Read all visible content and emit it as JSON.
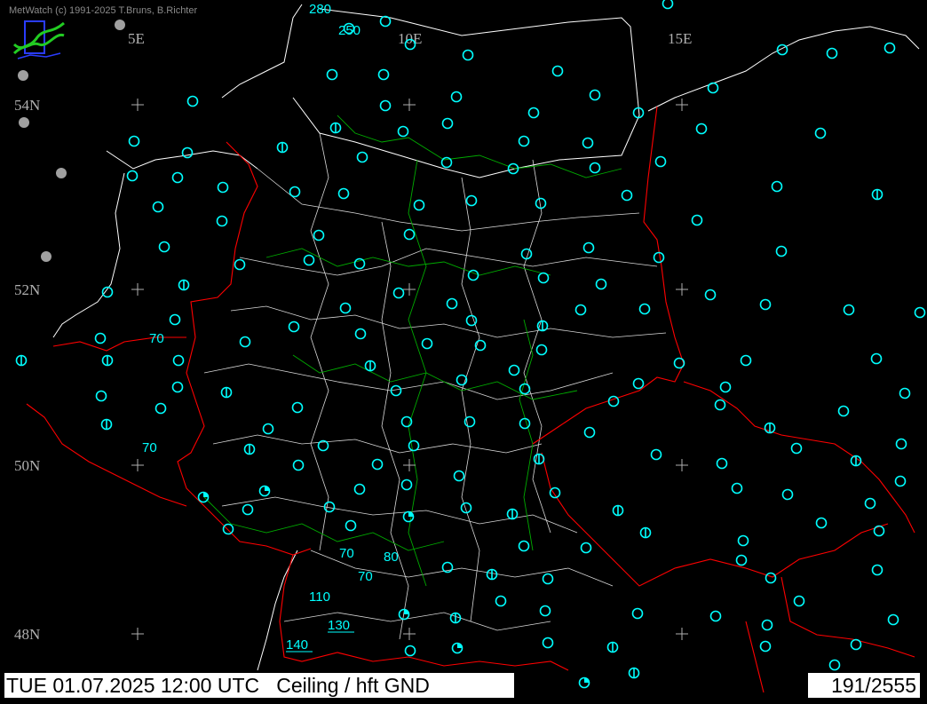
{
  "header": {
    "copyright": "MetWatch  (c) 1991-2025 T.Bruns, B.Richter"
  },
  "footer": {
    "datetime": "TUE 01.07.2025 12:00 UTC",
    "parameter": "Ceiling / hft GND",
    "station_count": "191/2555"
  },
  "colors": {
    "background": "#000000",
    "coast_border": "#ffffff",
    "national_border": "#ff0000",
    "regional_border": "#00aa00",
    "station": "#00ffff",
    "grid_label": "#b0b0b0"
  },
  "grid": {
    "lon_labels": [
      "5E",
      "10E",
      "15E"
    ],
    "lat_labels": [
      "54N",
      "52N",
      "50N",
      "48N"
    ]
  },
  "ceiling_values": [
    "280",
    "250",
    "70",
    "70",
    "70",
    "80",
    "70",
    "110",
    "130",
    "140"
  ],
  "station_symbols": {
    "clear_icon": "circle-station-icon",
    "few_icon": "circle-bar-station-icon",
    "scattered_icon": "circle-quarter-station-icon",
    "missing_icon": "grey-dot-station-icon"
  }
}
